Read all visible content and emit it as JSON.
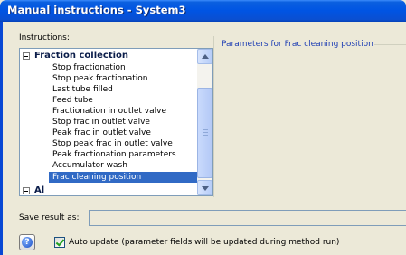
{
  "window": {
    "title": "Manual instructions - System3"
  },
  "instructions": {
    "label": "Instructions:",
    "parent": {
      "label": "Fraction collection",
      "expander": "minus-expander"
    },
    "items": [
      "Stop fractionation",
      "Stop peak fractionation",
      "Last tube filled",
      "Feed tube",
      "Fractionation in outlet valve",
      "Stop frac in outlet valve",
      "Peak frac in outlet valve",
      "Stop peak frac in outlet valve",
      "Peak fractionation parameters",
      "Accumulator wash"
    ],
    "selected": "Frac cleaning position",
    "next_partial": "Al"
  },
  "parameters": {
    "group_title": "Parameters for Frac cleaning position"
  },
  "save_result": {
    "label": "Save result as:",
    "value": ""
  },
  "auto_update": {
    "label": "Auto update (parameter fields will be updated during method run)",
    "checked": true
  },
  "icons": {
    "help": "help-icon"
  }
}
